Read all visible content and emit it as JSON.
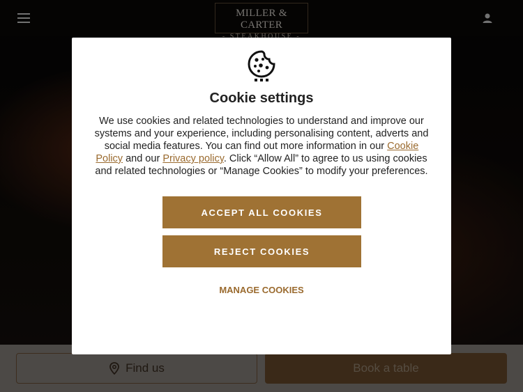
{
  "header": {
    "menu_icon": "hamburger-menu-icon",
    "logo_line1": "MILLER & CARTER",
    "logo_line2": "- STEAKHOUSE -",
    "account_icon": "user-icon"
  },
  "bottom_bar": {
    "find_us_label": "Find us",
    "find_us_icon": "location-pin-icon",
    "book_label": "Book a table"
  },
  "cookie_modal": {
    "icon": "cookie-icon",
    "title": "Cookie settings",
    "text_1": "We use cookies and related technologies to understand and improve our systems and your experience, including personalising content, adverts and social media features. You can find out more information in our ",
    "cookie_policy_link": "Cookie Policy",
    "text_2": " and our ",
    "privacy_policy_link": "Privacy policy",
    "text_3": ". Click “Allow All” to agree to us using cookies and related technologies or “Manage Cookies” to modify your preferences.",
    "accept_label": "ACCEPT ALL COOKIES",
    "reject_label": "REJECT COOKIES",
    "manage_label": "MANAGE COOKIES"
  },
  "colors": {
    "accent": "#9f7234",
    "link": "#9a6a2e",
    "book_button": "#6a4c2c"
  }
}
